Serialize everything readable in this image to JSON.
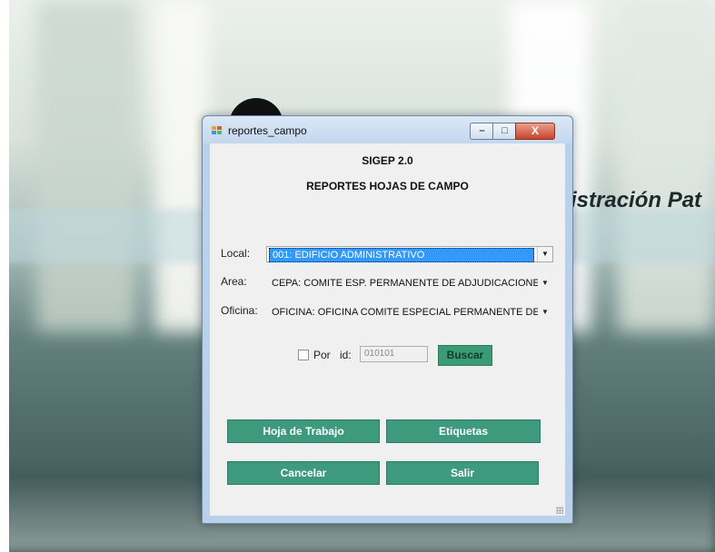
{
  "background": {
    "text": "istración Pat"
  },
  "window": {
    "title": "reportes_campo",
    "controls": {
      "minimize": "–",
      "maximize": "□",
      "close": "X"
    }
  },
  "form": {
    "header": "SIGEP 2.0",
    "subheader": "REPORTES HOJAS DE CAMPO",
    "local_label": "Local:",
    "local_value": "001: EDIFICIO ADMINISTRATIVO",
    "area_label": "Area:",
    "area_value": "CEPA: COMITE ESP. PERMANENTE DE ADJUDICACIONES",
    "oficina_label": "Oficina:",
    "oficina_value": "OFICINA: OFICINA COMITE ESPECIAL PERMANENTE DE ADJUDICACIONES",
    "por_label": "Por",
    "id_label": "id:",
    "id_value": "010101",
    "buscar": "Buscar",
    "hoja_trabajo": "Hoja de Trabajo",
    "etiquetas": "Etiquetas",
    "cancelar": "Cancelar",
    "salir": "Salir"
  },
  "colors": {
    "button_bg": "#3e9a7d",
    "selection": "#3399ff"
  }
}
